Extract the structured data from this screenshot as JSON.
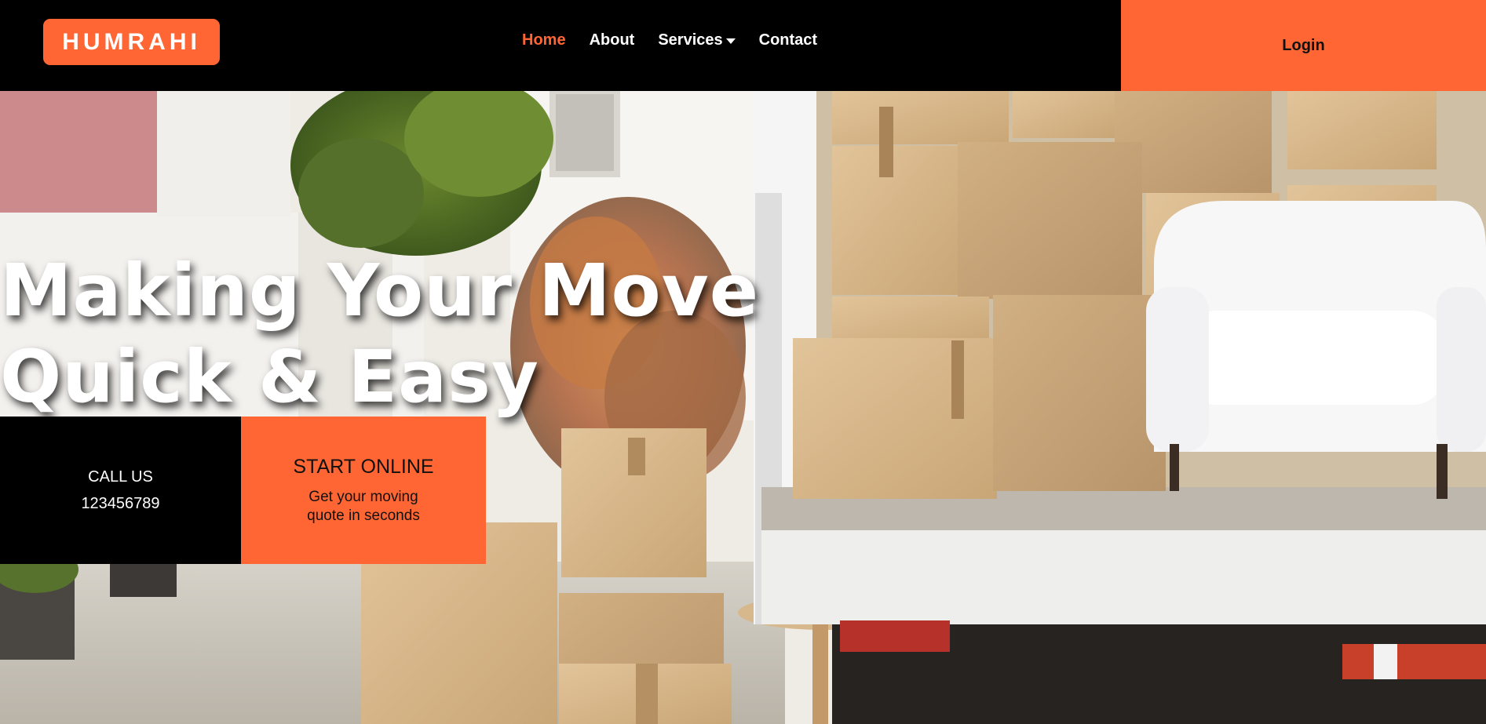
{
  "brand": {
    "name": "HUMRAHI"
  },
  "nav": {
    "items": [
      {
        "label": "Home",
        "active": true
      },
      {
        "label": "About"
      },
      {
        "label": "Services",
        "dropdown": true
      },
      {
        "label": "Contact"
      }
    ],
    "login_label": "Login"
  },
  "hero": {
    "title_line1": "Making Your Move",
    "title_line2": "Quick & Easy",
    "call": {
      "label": "CALL US",
      "number": "123456789"
    },
    "start": {
      "label": "START ONLINE",
      "subtitle": "Get your moving quote in seconds"
    }
  },
  "colors": {
    "accent": "#ff6633",
    "nav_bg": "#000000",
    "text_light": "#ffffff"
  }
}
